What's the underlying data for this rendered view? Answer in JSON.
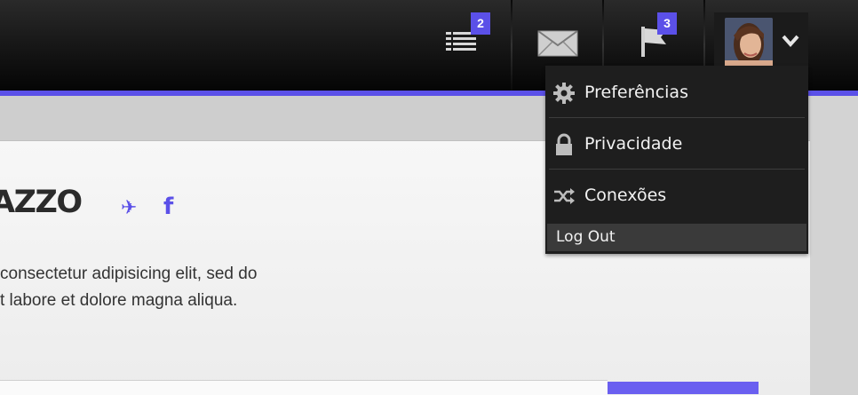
{
  "navbar": {
    "tasks_badge": "2",
    "notifications_badge": "3",
    "accent_color": "#5b50e8"
  },
  "user_menu": {
    "items": [
      {
        "label": "Preferências",
        "icon": "gear-icon"
      },
      {
        "label": "Privacidade",
        "icon": "lock-icon"
      },
      {
        "label": "Conexões",
        "icon": "shuffle-icon"
      }
    ],
    "logout_label": "Log Out"
  },
  "profile": {
    "name_partial": "AZZO",
    "social_icons": [
      "twitter-icon",
      "facebook-icon"
    ],
    "twitter_glyph": "✈",
    "facebook_glyph": "f",
    "bio_lines": [
      "consectetur adipisicing elit, sed do",
      "t labore et dolore magna aliqua."
    ]
  }
}
